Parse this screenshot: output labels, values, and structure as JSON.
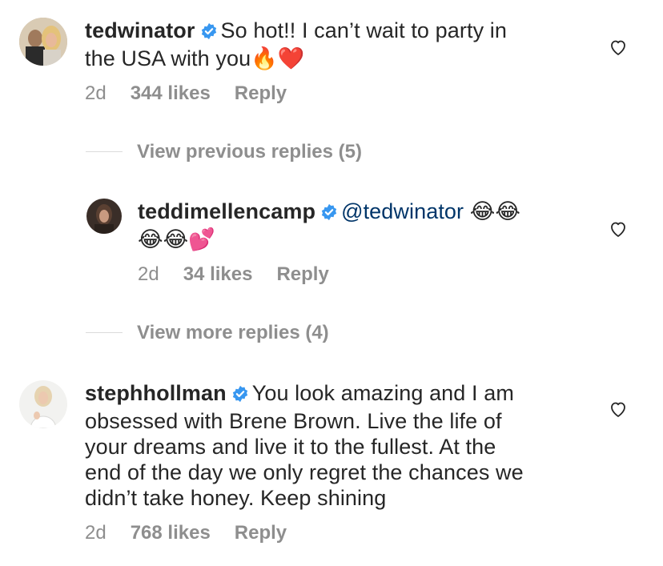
{
  "comments": [
    {
      "username": "tedwinator",
      "text_line1": "So hot!! I can’t wait to party in",
      "text_line2": "the USA with you",
      "emoji": "🔥❤️",
      "time": "2d",
      "likes": "344 likes",
      "reply": "Reply"
    },
    {
      "username": "teddimellencamp",
      "mention": "@tedwinator",
      "emoji_line1": "😂😂",
      "emoji_line2": "😂😂💕",
      "time": "2d",
      "likes": "34 likes",
      "reply": "Reply"
    },
    {
      "username": "stephhollman",
      "text_line1": "You look amazing and I am",
      "text_line2": "obsessed with Brene Brown.  Live the life of",
      "text_line3": "your dreams and live it to the fullest.  At the",
      "text_line4": "end of the day we only regret the chances we",
      "text_line5": "didn’t take honey.  Keep shining",
      "time": "2d",
      "likes": "768 likes",
      "reply": "Reply"
    }
  ],
  "view_previous_replies": "View previous replies (5)",
  "view_more_replies": "View more replies (4)",
  "colors": {
    "text": "#262626",
    "secondary": "#8e8e8e",
    "verified": "#3897f0",
    "mention": "#003569"
  }
}
